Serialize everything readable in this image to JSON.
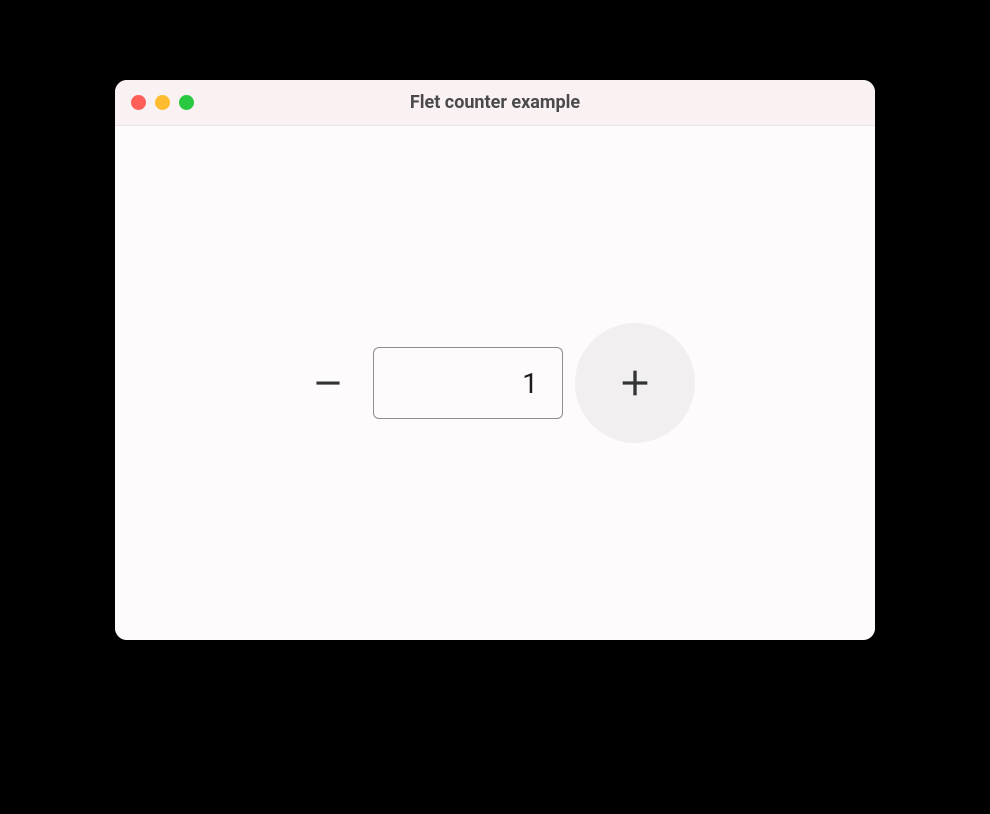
{
  "window": {
    "title": "Flet counter example"
  },
  "counter": {
    "value": "1",
    "minus_label": "Remove",
    "plus_label": "Add"
  },
  "colors": {
    "titlebar_bg": "#faf1f3",
    "body_bg": "#fefbfc",
    "button_highlight_bg": "#f2eff0",
    "traffic_red": "#ff5f57",
    "traffic_yellow": "#febc2e",
    "traffic_green": "#28c840"
  }
}
